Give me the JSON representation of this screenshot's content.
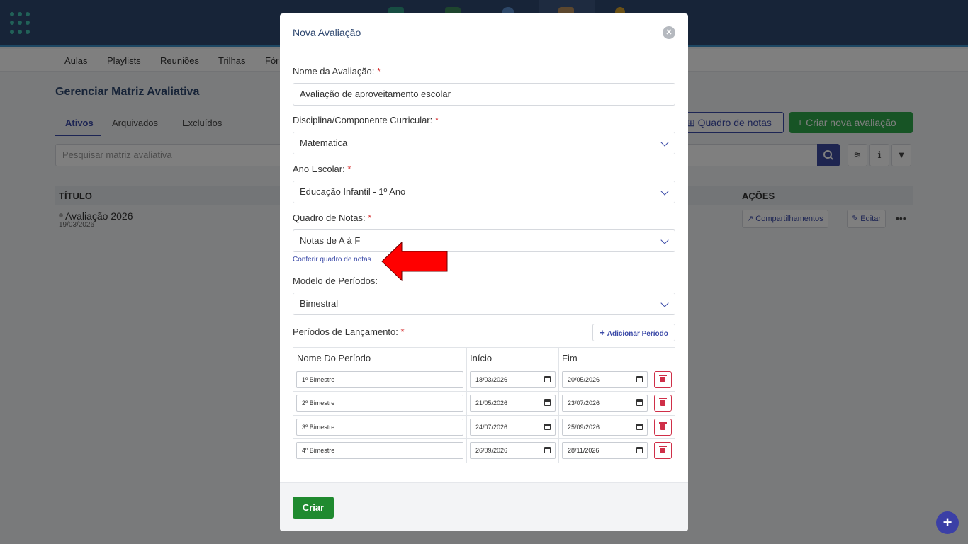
{
  "background": {
    "subnav": [
      "Aulas",
      "Playlists",
      "Reuniões",
      "Trilhas",
      "Fór"
    ],
    "page_title": "Gerenciar Matriz Avaliativa",
    "tabs": [
      "Ativos",
      "Arquivados",
      "Excluídos"
    ],
    "search_placeholder": "Pesquisar matriz avaliativa",
    "buttons": {
      "grade_board": "Quadro de notas",
      "create_new": "Criar nova avaliação"
    },
    "table": {
      "col_title": "TÍTULO",
      "col_actions": "AÇÕES",
      "row": {
        "title": "Avaliação 2026",
        "date": "19/03/2026",
        "share": "Compartilhamentos",
        "edit": "Editar"
      }
    }
  },
  "modal": {
    "title": "Nova Avaliação",
    "fields": {
      "name": {
        "label": "Nome da Avaliação:",
        "value": "Avaliação de aproveitamento escolar"
      },
      "discipline": {
        "label": "Disciplina/Componente Curricular:",
        "value": "Matematica"
      },
      "school_year": {
        "label": "Ano Escolar:",
        "value": "Educação Infantil - 1º Ano"
      },
      "grade_board": {
        "label": "Quadro de Notas:",
        "value": "Notas de A à F"
      },
      "period_model": {
        "label": "Modelo de Períodos:",
        "value": "Bimestral"
      }
    },
    "required_mark": "*",
    "check_link": "Conferir quadro de notas",
    "periods": {
      "label": "Períodos de Lançamento:",
      "add_label": "Adicionar Período",
      "headers": [
        "Nome Do Período",
        "Início",
        "Fim"
      ],
      "rows": [
        {
          "name": "1º Bimestre",
          "start": "18/03/2026",
          "end": "20/05/2026"
        },
        {
          "name": "2º Bimestre",
          "start": "21/05/2026",
          "end": "23/07/2026"
        },
        {
          "name": "3º Bimestre",
          "start": "24/07/2026",
          "end": "25/09/2026"
        },
        {
          "name": "4º Bimestre",
          "start": "26/09/2026",
          "end": "28/11/2026"
        }
      ]
    },
    "submit_label": "Criar"
  },
  "fab_label": "+",
  "colors": {
    "primary": "#3b4aa8",
    "success": "#1f8a2f",
    "danger": "#cf2f48",
    "header": "#2f4870",
    "annotation_arrow": "#ff0000"
  }
}
